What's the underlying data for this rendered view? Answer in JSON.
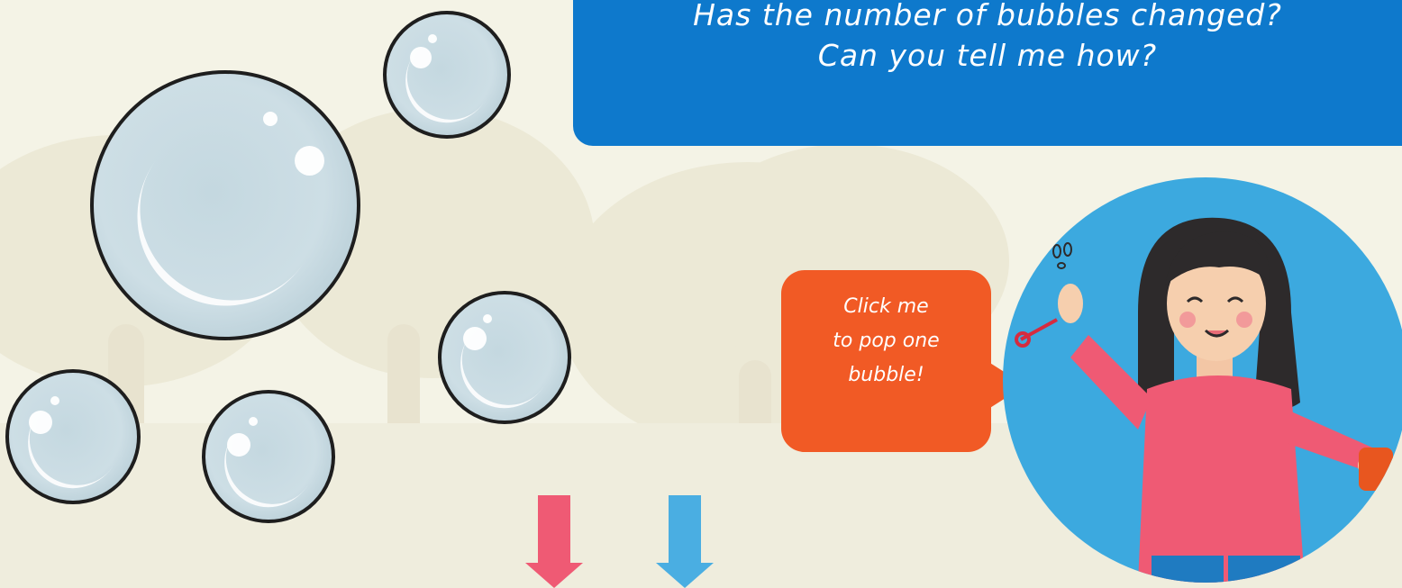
{
  "prompt": {
    "line1": "Has the number of bubbles changed?",
    "line2": "Can you tell me how?"
  },
  "speech_bubble": {
    "text": "Click me\nto pop one\nbubble!"
  },
  "bubbles": {
    "count": 5,
    "color": "#c9dce3",
    "outline_color": "#1e1e1e"
  },
  "colors": {
    "prompt_bg": "#0e79cc",
    "speech_bg": "#f15a25",
    "character_circle": "#3ca9df",
    "arrow_pink": "#ef5a74",
    "arrow_blue": "#4aaee2",
    "background": "#f4f3e6"
  },
  "icons": {
    "arrow_left": "down-arrow-icon",
    "arrow_right": "down-arrow-icon",
    "character": "girl-blowing-bubbles-icon"
  }
}
